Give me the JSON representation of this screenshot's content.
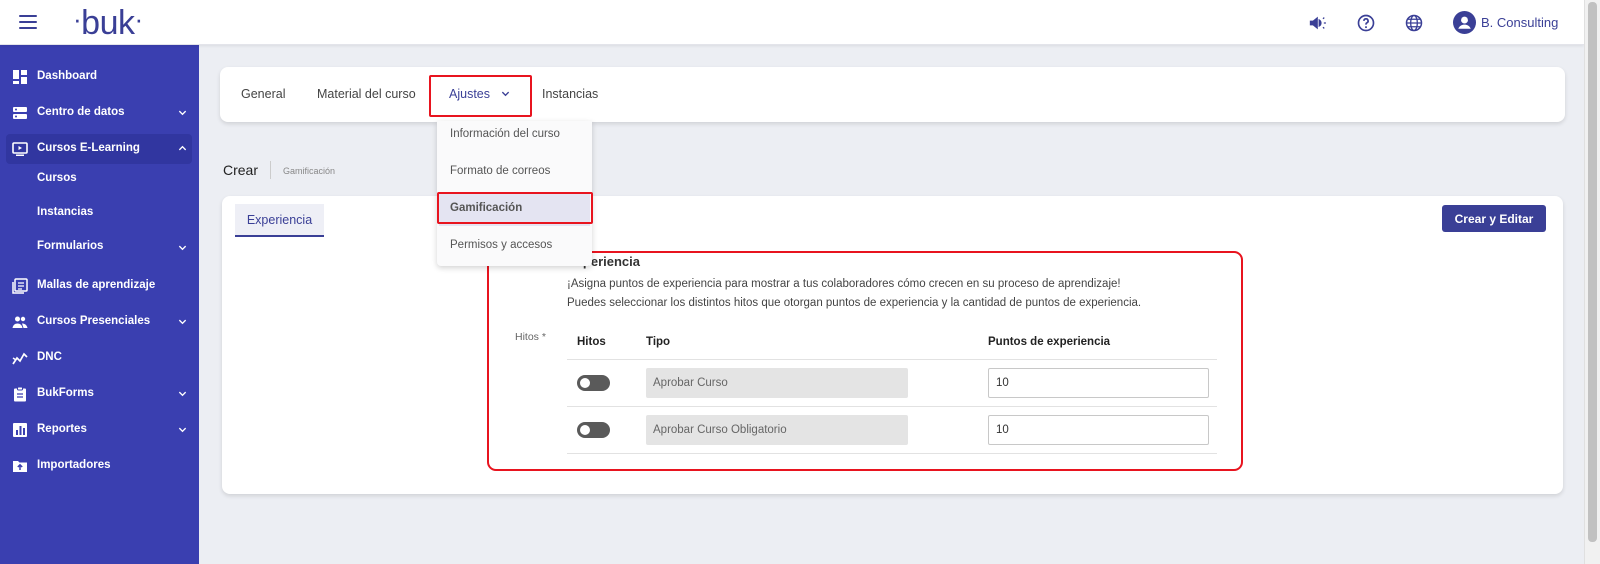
{
  "header": {
    "logo": "buk",
    "username": "B. Consulting",
    "icons": [
      "megaphone-icon",
      "help-icon",
      "globe-icon",
      "user-avatar-icon"
    ]
  },
  "sidebar": {
    "items": [
      {
        "label": "Dashboard",
        "icon": "dashboard-icon"
      },
      {
        "label": "Centro de datos",
        "icon": "database-icon"
      },
      {
        "label": "Cursos E-Learning",
        "icon": "monitor-play-icon"
      },
      {
        "label": "Mallas de aprendizaje",
        "icon": "document-list-icon"
      },
      {
        "label": "Cursos Presenciales",
        "icon": "people-icon"
      },
      {
        "label": "DNC",
        "icon": "chart-line-icon"
      },
      {
        "label": "BukForms",
        "icon": "clipboard-icon"
      },
      {
        "label": "Reportes",
        "icon": "bar-chart-icon"
      },
      {
        "label": "Importadores",
        "icon": "folder-upload-icon"
      }
    ],
    "sub_items": [
      {
        "label": "Cursos"
      },
      {
        "label": "Instancias"
      },
      {
        "label": "Formularios"
      }
    ]
  },
  "tabs": [
    {
      "label": "General"
    },
    {
      "label": "Material del curso"
    },
    {
      "label": "Ajustes"
    },
    {
      "label": "Instancias"
    }
  ],
  "dropdown": {
    "items": [
      {
        "label": "Información del curso"
      },
      {
        "label": "Formato de correos"
      },
      {
        "label": "Gamificación"
      },
      {
        "label": "Permisos y accesos"
      }
    ]
  },
  "breadcrumb": {
    "title": "Crear",
    "sub": "Gamificación"
  },
  "card": {
    "tab_label": "Experiencia",
    "button_label": "Crear y Editar"
  },
  "section": {
    "title": "Experiencia",
    "desc1": "¡Asigna puntos de experiencia para mostrar a tus colaboradores cómo crecen en su proceso de aprendizaje!",
    "desc2": "Puedes seleccionar los distintos hitos que otorgan puntos de experiencia y la cantidad de puntos de experiencia.",
    "hitos_label": "Hitos *"
  },
  "table": {
    "headers": {
      "hitos": "Hitos",
      "tipo": "Tipo",
      "puntos": "Puntos de experiencia"
    },
    "rows": [
      {
        "enabled": false,
        "tipo": "Aprobar Curso",
        "puntos": "10"
      },
      {
        "enabled": false,
        "tipo": "Aprobar Curso Obligatorio",
        "puntos": "10"
      }
    ]
  },
  "colors": {
    "brand": "#3a3f96",
    "sidebar": "#3a3fb0",
    "highlight": "#e8141f"
  }
}
